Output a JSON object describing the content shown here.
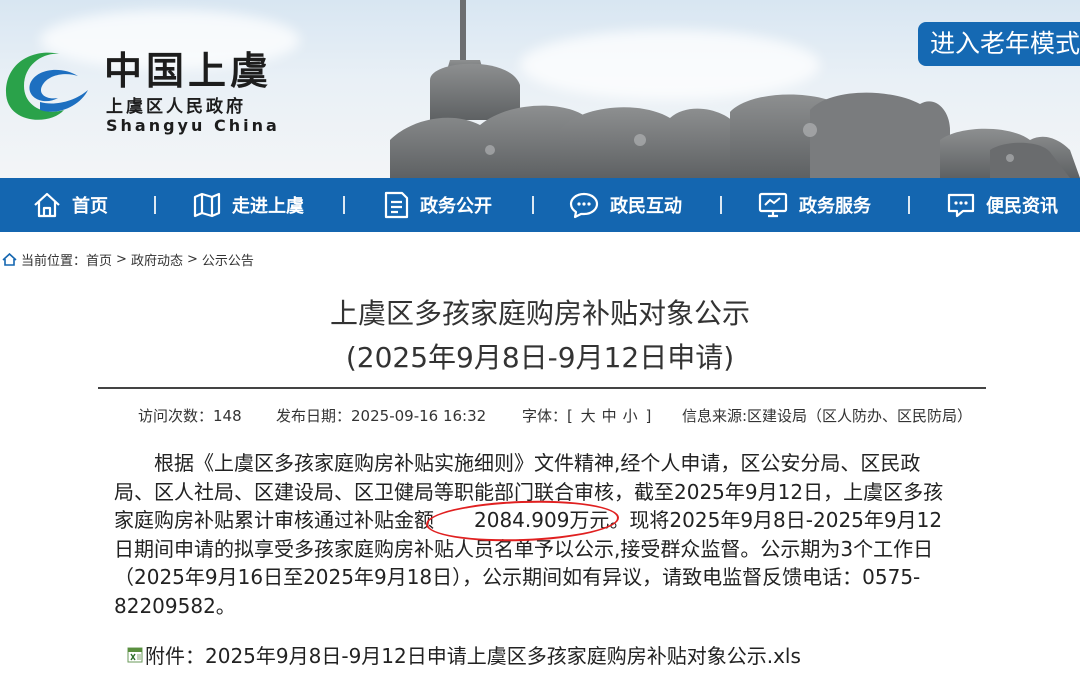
{
  "header": {
    "brand_cn": "中国上虞",
    "brand_sub": "上虞区人民政府",
    "brand_en": "Shangyu China",
    "elder_mode": "进入老年模式"
  },
  "nav": {
    "items": [
      {
        "label": "首页",
        "icon": "home-icon"
      },
      {
        "label": "走进上虞",
        "icon": "map-icon"
      },
      {
        "label": "政务公开",
        "icon": "document-icon"
      },
      {
        "label": "政民互动",
        "icon": "chat-icon"
      },
      {
        "label": "政务服务",
        "icon": "monitor-icon"
      },
      {
        "label": "便民资讯",
        "icon": "message-icon"
      }
    ]
  },
  "breadcrumb": {
    "label": "当前位置：",
    "items": [
      "首页",
      "政府动态",
      "公示公告"
    ],
    "separator": ">"
  },
  "article": {
    "title_line1": "上虞区多孩家庭购房补贴对象公示",
    "title_line2": "(2025年9月8日-9月12日申请)",
    "meta": {
      "views_label": "访问次数：",
      "views": "148",
      "date_label": "发布日期：",
      "date": "2025-09-16 16:32",
      "font_label": "字体：[",
      "font_large": "大",
      "font_medium": "中",
      "font_small": "小",
      "font_close": "]",
      "source": "信息来源:区建设局（区人防办、区民防局）"
    },
    "body_before": "根据《上虞区多孩家庭购房补贴实施细则》文件精神,经个人申请，区公安分局、区民政局、区人社局、区建设局、区卫健局等职能部门联合审核，截至2025年9月12日，上虞区多孩家庭购房补贴累计审核通过补贴金额",
    "body_amount": "2084.909万元",
    "body_after": "。现将2025年9月8日-2025年9月12日期间申请的拟享受多孩家庭购房补贴人员名单予以公示,接受群众监督。公示期为3个工作日（2025年9月16日至2025年9月18日），公示期间如有异议，请致电监督反馈电话：0575-82209582。",
    "attachment_label": "附件：",
    "attachment_name": "2025年9月8日-9月12日申请上虞区多孩家庭购房补贴对象公示.xls"
  },
  "colors": {
    "nav_blue": "#1466b0",
    "elder_btn": "#1569b3",
    "highlight_circle": "#e02020"
  }
}
